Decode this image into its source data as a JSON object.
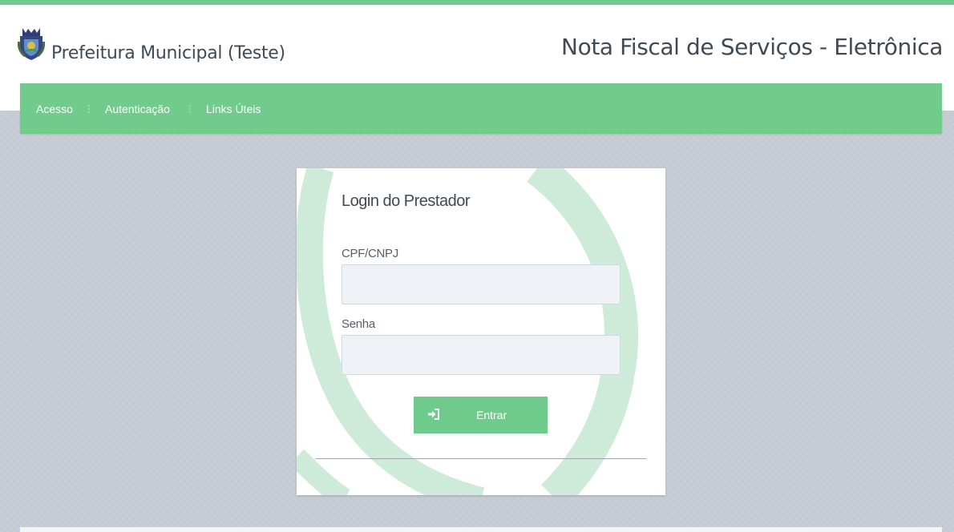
{
  "header": {
    "municipality": "Prefeitura Municipal (Teste)",
    "system_title": "Nota Fiscal de Serviços - Eletrônica",
    "logo_icon": "coat-of-arms-icon"
  },
  "nav": {
    "items": [
      {
        "label": "Acesso"
      },
      {
        "label": "Autenticação"
      },
      {
        "label": "Links Úteis"
      }
    ]
  },
  "login": {
    "title": "Login do Prestador",
    "cpf_label": "CPF/CNPJ",
    "cpf_value": "",
    "senha_label": "Senha",
    "senha_value": "",
    "button_label": "Entrar",
    "button_icon": "sign-in-icon"
  },
  "colors": {
    "accent": "#70cb8c",
    "background": "#c5cbd2",
    "text": "#3e4a54"
  }
}
